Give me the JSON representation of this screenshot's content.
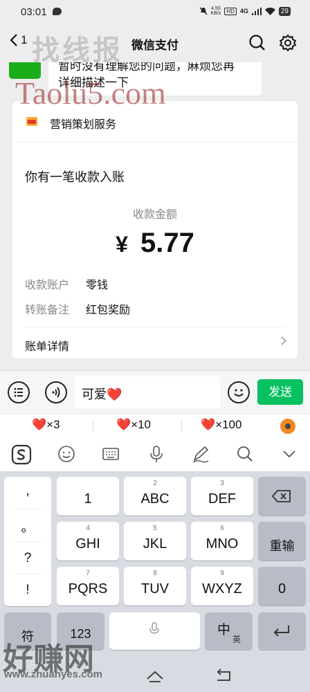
{
  "status": {
    "time": "03:01",
    "speed_value": "4.50",
    "speed_unit": "KB/s",
    "hd": "HD",
    "network": "4G",
    "battery": "29"
  },
  "nav": {
    "back_count": "1",
    "title": "微信支付"
  },
  "chat": {
    "bubble_line1": "暂时没有理解您的问题，麻烦您再",
    "bubble_line2": "详细描述一下"
  },
  "card": {
    "service_name": "营销策划服务",
    "headline": "你有一笔收款入账",
    "amount_label": "收款金额",
    "currency": "¥",
    "amount": "5.77",
    "account_key": "收款账户",
    "account_value": "零钱",
    "memo_key": "转账备注",
    "memo_value": "红包奖励",
    "details_label": "账单详情"
  },
  "input": {
    "text": "可爱❤️",
    "send_label": "发送"
  },
  "suggestions": [
    {
      "heart": "❤️",
      "count": "×3"
    },
    {
      "heart": "❤️",
      "count": "×10"
    },
    {
      "heart": "❤️",
      "count": "×100"
    }
  ],
  "keyboard": {
    "symbols": [
      ",",
      "。",
      "?",
      "!"
    ],
    "keys": [
      {
        "num": "",
        "label": "1"
      },
      {
        "num": "2",
        "label": "ABC"
      },
      {
        "num": "3",
        "label": "DEF"
      },
      {
        "num": "4",
        "label": "GHI"
      },
      {
        "num": "5",
        "label": "JKL"
      },
      {
        "num": "6",
        "label": "MNO"
      },
      {
        "num": "7",
        "label": "PQRS"
      },
      {
        "num": "8",
        "label": "TUV"
      },
      {
        "num": "9",
        "label": "WXYZ"
      }
    ],
    "reenter": "重输",
    "zero": "0",
    "sym": "符",
    "num123": "123",
    "lang_main": "中",
    "lang_sub": "英"
  },
  "watermarks": {
    "top": "找线报",
    "middle": "Taolu5.com",
    "bottom": "好赚网",
    "bottom_url": "www.zhuanyes.com"
  }
}
